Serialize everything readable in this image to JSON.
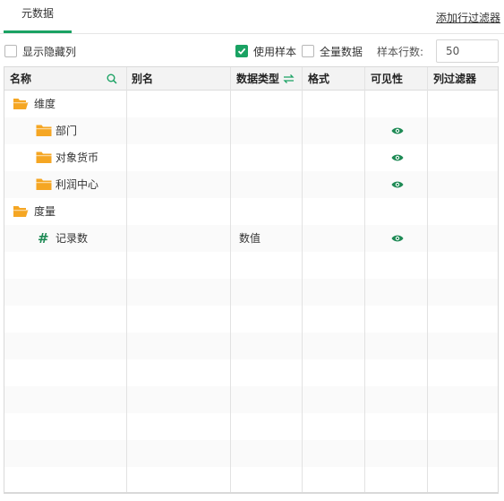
{
  "tabs": [
    {
      "label": "元数据"
    }
  ],
  "add_filter_label": "添加行过滤器",
  "toolbar": {
    "show_hidden": {
      "label": "显示隐藏列",
      "checked": false
    },
    "use_sample": {
      "label": "使用样本",
      "checked": true
    },
    "full_data": {
      "label": "全量数据",
      "checked": false
    },
    "sample_rows_label": "样本行数:",
    "sample_rows_value": "50"
  },
  "columns": [
    "名称",
    "别名",
    "数据类型",
    "格式",
    "可见性",
    "列过滤器"
  ],
  "rows": [
    {
      "kind": "group",
      "icon": "folder-open-icon",
      "label": "维度"
    },
    {
      "kind": "field",
      "icon": "folder-icon",
      "label": "部门",
      "visible": true
    },
    {
      "kind": "field",
      "icon": "folder-icon",
      "label": "对象货币",
      "visible": true
    },
    {
      "kind": "field",
      "icon": "folder-icon",
      "label": "利润中心",
      "visible": true
    },
    {
      "kind": "group",
      "icon": "folder-open-icon",
      "label": "度量"
    },
    {
      "kind": "field",
      "icon": "hash-icon",
      "label": "记录数",
      "type": "数值",
      "visible": true
    }
  ],
  "colors": {
    "accent": "#1aa263",
    "folder": "#f5a623",
    "eye": "#1e8a55"
  }
}
